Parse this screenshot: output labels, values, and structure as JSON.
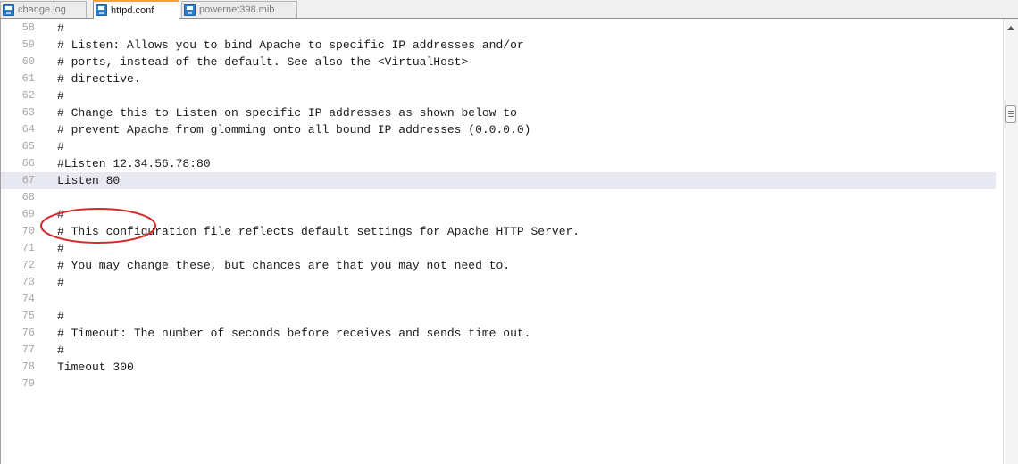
{
  "tabs": [
    {
      "label": "change.log",
      "active": false,
      "icon": "save-file-icon"
    },
    {
      "label": "httpd.conf",
      "active": true,
      "icon": "save-file-icon"
    },
    {
      "label": "powernet398.mib",
      "active": false,
      "icon": "save-file-icon"
    }
  ],
  "editor": {
    "current_line": 67,
    "lines": [
      {
        "num": "58",
        "text": "#"
      },
      {
        "num": "59",
        "text": "# Listen: Allows you to bind Apache to specific IP addresses and/or"
      },
      {
        "num": "60",
        "text": "# ports, instead of the default. See also the <VirtualHost>"
      },
      {
        "num": "61",
        "text": "# directive."
      },
      {
        "num": "62",
        "text": "#"
      },
      {
        "num": "63",
        "text": "# Change this to Listen on specific IP addresses as shown below to"
      },
      {
        "num": "64",
        "text": "# prevent Apache from glomming onto all bound IP addresses (0.0.0.0)"
      },
      {
        "num": "65",
        "text": "#"
      },
      {
        "num": "66",
        "text": "#Listen 12.34.56.78:80"
      },
      {
        "num": "67",
        "text": "Listen 80"
      },
      {
        "num": "68",
        "text": ""
      },
      {
        "num": "69",
        "text": "#"
      },
      {
        "num": "70",
        "text": "# This configuration file reflects default settings for Apache HTTP Server."
      },
      {
        "num": "71",
        "text": "#"
      },
      {
        "num": "72",
        "text": "# You may change these, but chances are that you may not need to."
      },
      {
        "num": "73",
        "text": "#"
      },
      {
        "num": "74",
        "text": ""
      },
      {
        "num": "75",
        "text": "#"
      },
      {
        "num": "76",
        "text": "# Timeout: The number of seconds before receives and sends time out."
      },
      {
        "num": "77",
        "text": "#"
      },
      {
        "num": "78",
        "text": "Timeout 300"
      },
      {
        "num": "79",
        "text": ""
      }
    ]
  },
  "colors": {
    "active_tab_accent": "#f5a623",
    "current_line_highlight": "#e8e8f2",
    "annotation": "#d42a2a"
  }
}
